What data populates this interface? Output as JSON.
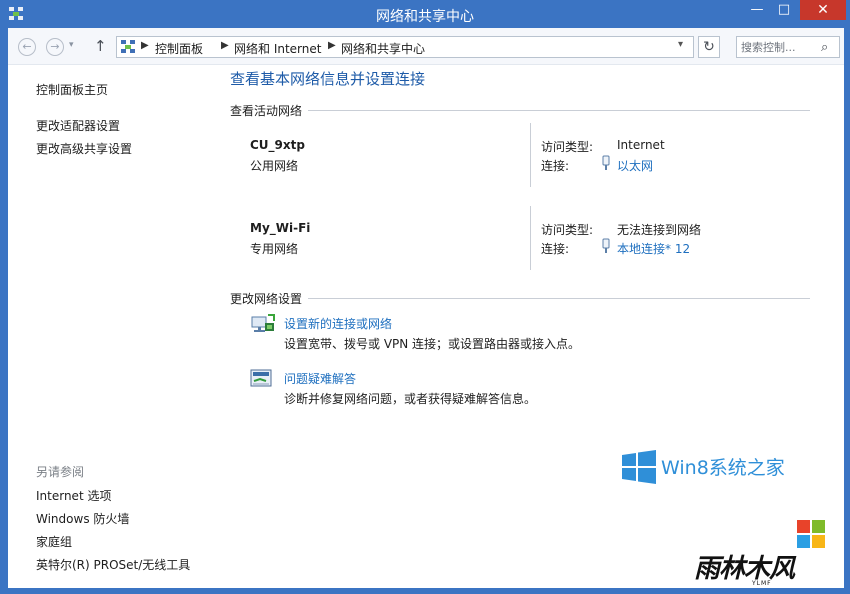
{
  "window": {
    "title": "网络和共享中心",
    "minimize": "—",
    "maximize": "□",
    "close": "✕"
  },
  "nav": {
    "back": "←",
    "forward": "→",
    "dropdown": "▾",
    "up": "↑",
    "breadcrumb": [
      "控制面板",
      "网络和 Internet",
      "网络和共享中心"
    ],
    "refresh": "↻",
    "search_placeholder": "搜索控制...",
    "search_icon": "⌕"
  },
  "sidebar": {
    "home": "控制面板主页",
    "links": [
      "更改适配器设置",
      "更改高级共享设置"
    ],
    "see_also_heading": "另请参阅",
    "see_also": [
      "Internet 选项",
      "Windows 防火墙",
      "家庭组",
      "英特尔(R) PROSet/无线工具"
    ]
  },
  "main": {
    "title": "查看基本网络信息并设置连接",
    "active_networks_heading": "查看活动网络",
    "networks": [
      {
        "name": "CU_9xtp",
        "type": "公用网络",
        "access_label": "访问类型:",
        "access_value": "Internet",
        "connection_label": "连接:",
        "connection_value": "以太网"
      },
      {
        "name": "My_Wi-Fi",
        "type": "专用网络",
        "access_label": "访问类型:",
        "access_value": "无法连接到网络",
        "connection_label": "连接:",
        "connection_value": "本地连接* 12"
      }
    ],
    "change_settings_heading": "更改网络设置",
    "tasks": [
      {
        "icon": "network-setup-icon",
        "link": "设置新的连接或网络",
        "description": "设置宽带、拨号或 VPN 连接；或设置路由器或接入点。"
      },
      {
        "icon": "troubleshoot-icon",
        "link": "问题疑难解答",
        "description": "诊断并修复网络问题，或者获得疑难解答信息。"
      }
    ]
  },
  "watermarks": {
    "win8": "Win8系统之家",
    "ylmf": "雨林木风",
    "ylmf_sub": "YLMF"
  },
  "colors": {
    "titlebar": "#3b74c3",
    "link": "#1e6fbf",
    "page_title": "#1e5ba8"
  }
}
